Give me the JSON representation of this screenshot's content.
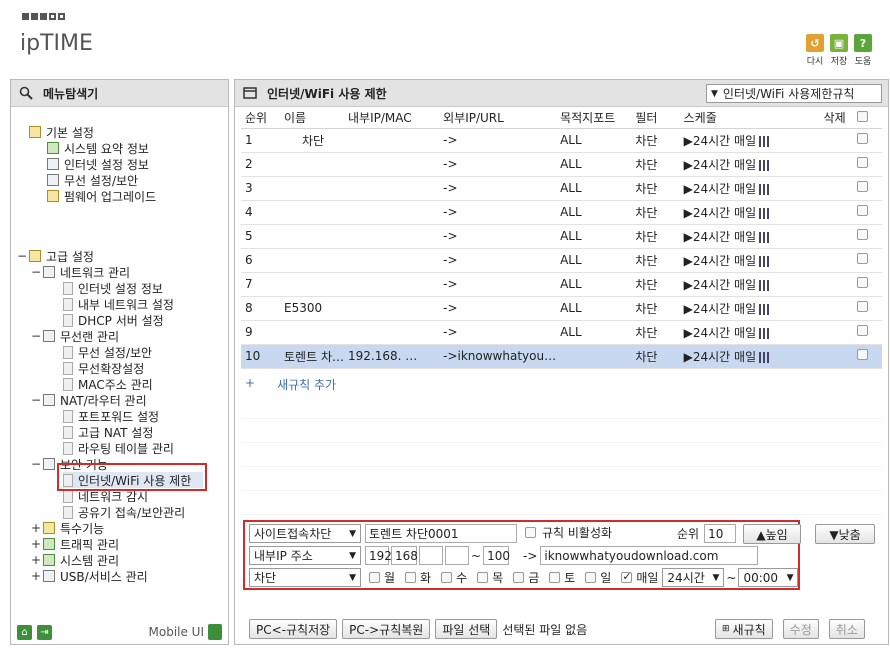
{
  "header": {
    "logo": "ipTIME",
    "buttons": [
      {
        "label": "다시",
        "icon": "refresh-icon",
        "color": "#e0a132"
      },
      {
        "label": "저장",
        "icon": "save-icon",
        "color": "#7ab33b"
      },
      {
        "label": "도움",
        "icon": "help-icon",
        "color": "#5aa63b"
      }
    ]
  },
  "left": {
    "title": "메뉴탐색기",
    "basic_title": "기본 설정",
    "basic_items": [
      "시스템 요약 정보",
      "인터넷 설정 정보",
      "무선 설정/보안",
      "펌웨어 업그레이드"
    ],
    "advanced_title": "고급 설정",
    "network_title": "네트워크 관리",
    "network_items": [
      "인터넷 설정 정보",
      "내부 네트워크 설정",
      "DHCP 서버 설정"
    ],
    "wireless_title": "무선랜 관리",
    "wireless_items": [
      "무선 설정/보안",
      "무선확장설정",
      "MAC주소 관리"
    ],
    "nat_title": "NAT/라우터 관리",
    "nat_items": [
      "포트포워드 설정",
      "고급 NAT 설정",
      "라우팅 테이블 관리"
    ],
    "security_title": "보안 기능",
    "security_items": [
      "인터넷/WiFi 사용 제한",
      "네트워크 감시",
      "공유기 접속/보안관리"
    ],
    "special": "특수기능",
    "traffic": "트래픽 관리",
    "system": "시스템 관리",
    "usb": "USB/서비스 관리",
    "mobile_ui": "Mobile UI"
  },
  "right": {
    "title": "인터넷/WiFi 사용 제한",
    "rule_select": "인터넷/WiFi 사용제한규칙",
    "columns": [
      "순위",
      "이름",
      "내부IP/MAC",
      "외부IP/URL",
      "목적지포트",
      "필터",
      "스케줄",
      "삭제"
    ],
    "rows": [
      {
        "rank": "1",
        "name": "차단",
        "ip": "",
        "arrow": "->",
        "url": "",
        "port": "ALL",
        "filter": "차단",
        "sched": "▶24시간 매일"
      },
      {
        "rank": "2",
        "name": "",
        "ip": "",
        "arrow": "->",
        "url": "",
        "port": "ALL",
        "filter": "차단",
        "sched": "▶24시간 매일"
      },
      {
        "rank": "3",
        "name": "",
        "ip": "",
        "arrow": "->",
        "url": "",
        "port": "ALL",
        "filter": "차단",
        "sched": "▶24시간 매일"
      },
      {
        "rank": "4",
        "name": "",
        "ip": "",
        "arrow": "->",
        "url": "",
        "port": "ALL",
        "filter": "차단",
        "sched": "▶24시간 매일"
      },
      {
        "rank": "5",
        "name": "",
        "ip": "",
        "arrow": "->",
        "url": "",
        "port": "ALL",
        "filter": "차단",
        "sched": "▶24시간 매일"
      },
      {
        "rank": "6",
        "name": "",
        "ip": "",
        "arrow": "->",
        "url": "",
        "port": "ALL",
        "filter": "차단",
        "sched": "▶24시간 매일"
      },
      {
        "rank": "7",
        "name": "",
        "ip": "",
        "arrow": "->",
        "url": "",
        "port": "ALL",
        "filter": "차단",
        "sched": "▶24시간 매일"
      },
      {
        "rank": "8",
        "name": "E5300",
        "ip": "",
        "arrow": "->",
        "url": "",
        "port": "ALL",
        "filter": "차단",
        "sched": "▶24시간 매일"
      },
      {
        "rank": "9",
        "name": "",
        "ip": "",
        "arrow": "->",
        "url": "",
        "port": "ALL",
        "filter": "차단",
        "sched": "▶24시간 매일"
      },
      {
        "rank": "10",
        "name": "토렌트 차…",
        "ip": "192.168.  …",
        "arrow": "->",
        "url": "iknowwhatyou…",
        "port": "",
        "filter": "차단",
        "sched": "▶24시간 매일"
      }
    ],
    "add_rule_plus": "+",
    "add_rule": "새규칙 추가",
    "editor": {
      "type_select": "사이트접속차단",
      "name_value": "토렌트 차단0001",
      "disable_label": "규칙 비활성화",
      "rank_label": "순위",
      "rank_value": "10",
      "up_button": "▲높임",
      "down_button": "▼낮춤",
      "ip_select": "내부IP 주소",
      "ip1": "192",
      "ip2": "168",
      "ip3": "",
      "ip4": "",
      "ip_tilde": "~",
      "ip_end": "100",
      "url_arrow": "->",
      "url_value": "iknowwhatyoudownload.com",
      "action_select": "차단",
      "days": [
        "월",
        "화",
        "수",
        "목",
        "금",
        "토",
        "일"
      ],
      "everyday_label": "매일",
      "hours_select": "24시간",
      "time_tilde": "~",
      "time_select": "00:00"
    },
    "bottom": {
      "save_pc": "PC<-규칙저장",
      "restore_pc": "PC->규칙복원",
      "file_select": "파일 선택",
      "no_file": "선택된 파일 없음",
      "new_rule": "새규칙",
      "modify": "수정",
      "cancel": "취소"
    }
  }
}
